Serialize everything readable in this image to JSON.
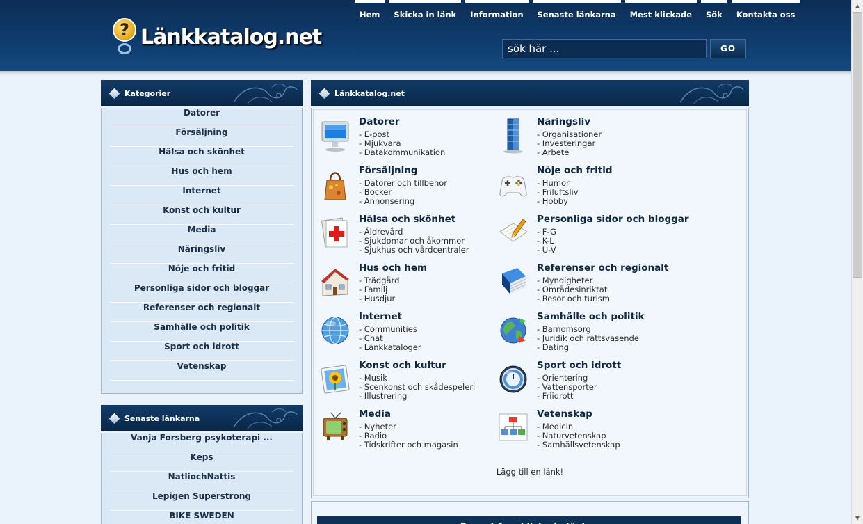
{
  "header": {
    "logo_text": "Länkkatalog.net",
    "logo_symbol": "?",
    "nav": [
      "Hem",
      "Skicka in länk",
      "Information",
      "Senaste länkarna",
      "Mest klickade",
      "Sök",
      "Kontakta oss"
    ],
    "search_placeholder": "sök här ...",
    "go_label": "GO"
  },
  "sidebar_categories": {
    "title": "Kategorier",
    "items": [
      "Datorer",
      "Försäljning",
      "Hälsa och skönhet",
      "Hus och hem",
      "Internet",
      "Konst och kultur",
      "Media",
      "Näringsliv",
      "Nöje och fritid",
      "Personliga sidor och bloggar",
      "Referenser och regionalt",
      "Samhälle och politik",
      "Sport och idrott",
      "Vetenskap"
    ]
  },
  "sidebar_latest": {
    "title": "Senaste länkarna",
    "items": [
      "Vanja Forsberg psykoterapi ...",
      "Keps",
      "NatliochNattis",
      "Lepigen Superstrong",
      "BIKE SWEDEN"
    ]
  },
  "main": {
    "title": "Länkkatalog.net",
    "categories": [
      {
        "title": "Datorer",
        "icon": "monitor-icon",
        "subs": [
          "- E-post",
          "- Mjukvara",
          "- Datakommunikation"
        ]
      },
      {
        "title": "Näringsliv",
        "icon": "skyscraper-icon",
        "subs": [
          "- Organisationer",
          "- Investeringar",
          "- Arbete"
        ]
      },
      {
        "title": "Försäljning",
        "icon": "handbag-icon",
        "subs": [
          "- Datorer och tillbehör",
          "- Böcker",
          "- Annonsering"
        ]
      },
      {
        "title": "Nöje och fritid",
        "icon": "gamepad-icon",
        "subs": [
          "- Humor",
          "- Friluftsliv",
          "- Hobby"
        ]
      },
      {
        "title": "Hälsa och skönhet",
        "icon": "first-aid-icon",
        "subs": [
          "- Äldrevård",
          "- Sjukdomar och åkommor",
          "- Sjukhus och vårdcentraler"
        ]
      },
      {
        "title": "Personliga sidor och bloggar",
        "icon": "notepad-pencil-icon",
        "subs": [
          "- F-G",
          "- K-L",
          "- U-V"
        ]
      },
      {
        "title": "Hus och hem",
        "icon": "house-icon",
        "subs": [
          "- Trädgård",
          "- Familj",
          "- Husdjur"
        ]
      },
      {
        "title": "Referenser och regionalt",
        "icon": "book-icon",
        "subs": [
          "- Myndigheter",
          "- Områdesinriktat",
          "- Resor och turism"
        ]
      },
      {
        "title": "Internet",
        "icon": "globe-icon",
        "subs": [
          "- Communities",
          "- Chat",
          "- Länkkataloger"
        ]
      },
      {
        "title": "Samhälle och politik",
        "icon": "world-arrows-icon",
        "subs": [
          "- Barnomsorg",
          "- Juridik och rättsväsende",
          "- Dating"
        ]
      },
      {
        "title": "Konst och kultur",
        "icon": "sunflower-picture-icon",
        "subs": [
          "- Musik",
          "- Scenkonst och skådespeleri",
          "- Illustrering"
        ]
      },
      {
        "title": "Sport och idrott",
        "icon": "stopwatch-icon",
        "subs": [
          "- Orientering",
          "- Vattensporter",
          "- Friidrott"
        ]
      },
      {
        "title": "Media",
        "icon": "tv-icon",
        "subs": [
          "- Nyheter",
          "- Radio",
          "- Tidskrifter och magasin"
        ]
      },
      {
        "title": "Vetenskap",
        "icon": "flowchart-icon",
        "subs": [
          "- Medicin",
          "- Naturvetenskap",
          "- Samhällsvetenskap"
        ]
      }
    ],
    "add_link_text": "Lägg till en länk!"
  },
  "bottom_panel": {
    "title": "Senast fem klickade länkar"
  }
}
